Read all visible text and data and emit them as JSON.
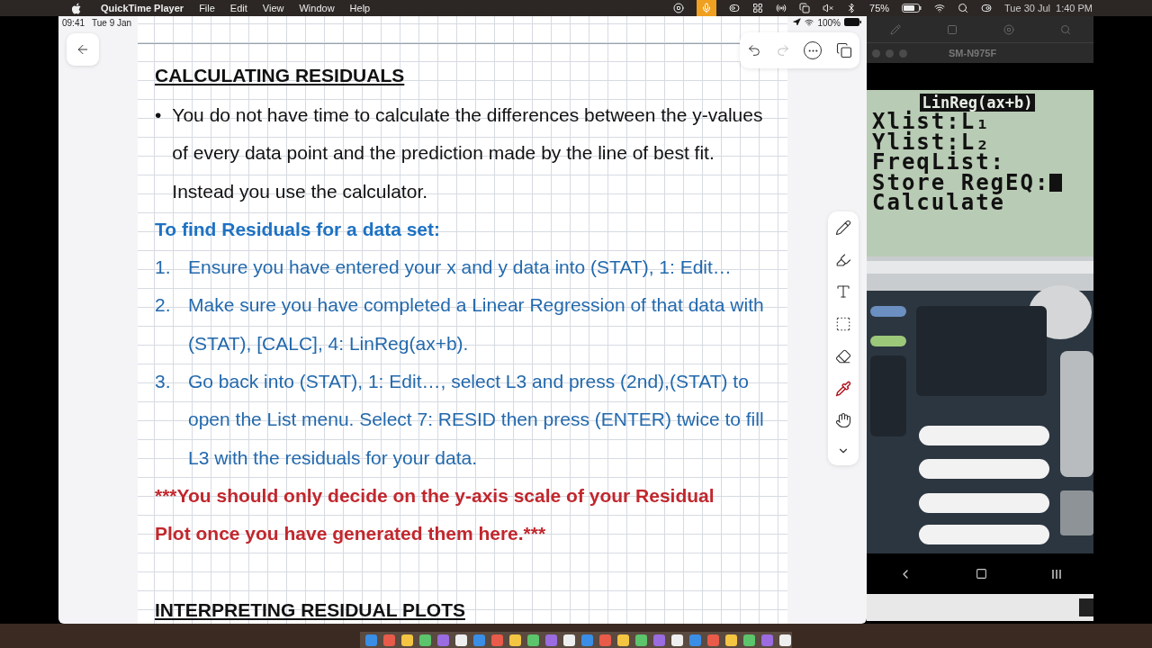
{
  "menu_bar": {
    "app": "QuickTime Player",
    "menus": [
      "File",
      "Edit",
      "View",
      "Window",
      "Help"
    ],
    "battery": "75%",
    "date": "Tue 30 Jul",
    "time": "1:40 PM"
  },
  "ipad": {
    "time": "09:41",
    "date": "Tue 9 Jan",
    "battery": "100%"
  },
  "note": {
    "heading": "CALCULATING RESIDUALS",
    "bullet_marker": "•",
    "bullets": [
      "You do not have time to calculate the differences between the y-values of every data point and the prediction made by the line of best fit. Instead you use the calculator."
    ],
    "subheading": "To find Residuals for a data set:",
    "steps": [
      {
        "number": "1.",
        "text": "Ensure you have entered your x and y data into (STAT), 1: Edit…"
      },
      {
        "number": "2.",
        "text": "Make sure you have completed a Linear Regression of that data with (STAT), [CALC], 4: LinReg(ax+b)."
      },
      {
        "number": "3.",
        "text": "Go back into (STAT), 1: Edit…, select L3 and press (2nd),(STAT) to open the List menu. Select 7: RESID then press (ENTER) twice to fill L3 with the residuals for your data."
      }
    ],
    "warning": "***You should only decide on the y-axis scale of your Residual Plot once you have generated them here.***",
    "next_heading": "INTERPRETING RESIDUAL PLOTS"
  },
  "phone": {
    "title": "SM-N975F",
    "screen": {
      "header": "LinReg(ax+b)",
      "lines": [
        "Xlist:L₁",
        "Ylist:L₂",
        "FreqList:",
        "Store RegEQ:",
        "Calculate"
      ]
    }
  }
}
